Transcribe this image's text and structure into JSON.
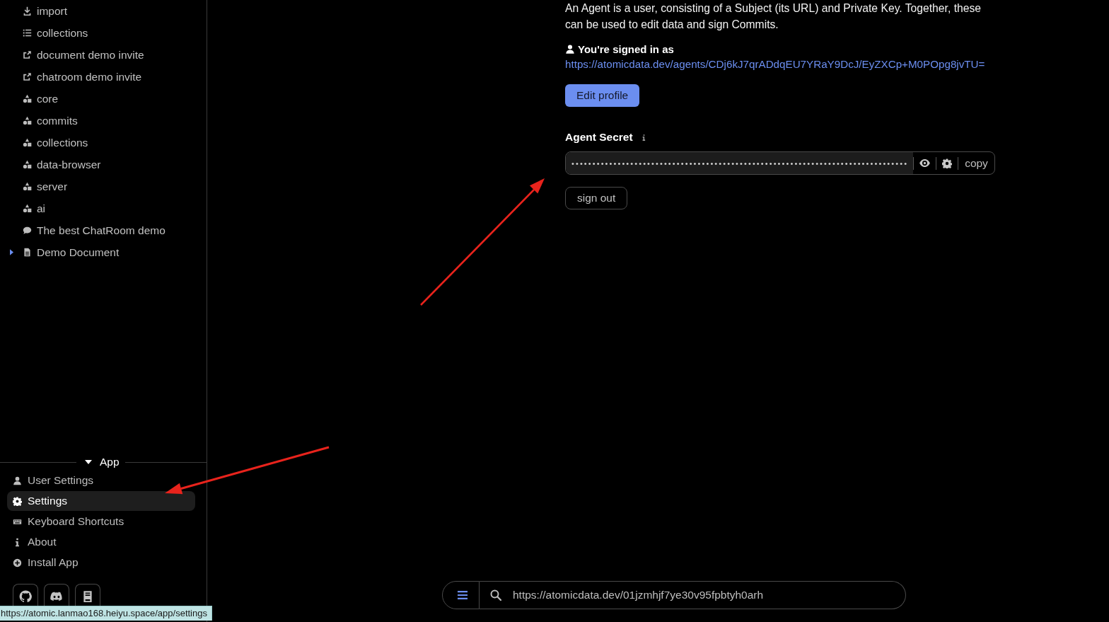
{
  "sidebar": {
    "items": [
      {
        "label": "import",
        "kind": "import",
        "selected": false
      },
      {
        "label": "collections",
        "kind": "collection",
        "selected": false
      },
      {
        "label": "document demo invite",
        "kind": "invite",
        "selected": false
      },
      {
        "label": "chatroom demo invite",
        "kind": "invite",
        "selected": false
      },
      {
        "label": "core",
        "kind": "ontology",
        "selected": false
      },
      {
        "label": "commits",
        "kind": "ontology",
        "selected": false
      },
      {
        "label": "collections",
        "kind": "ontology",
        "selected": false
      },
      {
        "label": "data-browser",
        "kind": "ontology",
        "selected": false
      },
      {
        "label": "server",
        "kind": "ontology",
        "selected": false
      },
      {
        "label": "ai",
        "kind": "ontology",
        "selected": false
      },
      {
        "label": "The best ChatRoom demo",
        "kind": "chatroom",
        "selected": false
      },
      {
        "label": "Demo Document",
        "kind": "document",
        "selected": false,
        "expanded": false
      }
    ],
    "app_menu": {
      "title": "App",
      "expanded": true,
      "items": [
        {
          "label": "User Settings",
          "kind": "user",
          "selected": false
        },
        {
          "label": "Settings",
          "kind": "settings",
          "selected": true
        },
        {
          "label": "Keyboard Shortcuts",
          "kind": "keyboard",
          "selected": false
        },
        {
          "label": "About",
          "kind": "about",
          "selected": false
        },
        {
          "label": "Install App",
          "kind": "install",
          "selected": false
        }
      ]
    },
    "footer_links": [
      {
        "kind": "github"
      },
      {
        "kind": "discord"
      },
      {
        "kind": "book"
      }
    ]
  },
  "agent": {
    "description": "An Agent is a user, consisting of a Subject (its URL) and Private Key. Together, these can be used to edit data and sign Commits.",
    "signed_in_label": "You're signed in as",
    "subject_link": "https://atomicdata.dev/agents/CDj6kJ7qrADdqEU7YRaY9DcJ/EyZXCp+M0POpg8jvTU=",
    "edit_button": "Edit profile",
    "secret": {
      "label": "Agent Secret",
      "value": "••••••••••••••••••••••••••••••••••••••••••••••••••••••••••••••••••••••••••••••••",
      "copy_button": "copy"
    },
    "sign_out_button": "sign out"
  },
  "navigation_bar": {
    "value": "https://atomicdata.dev/01jzmhjf7ye30v95fpbtyh0arh"
  },
  "status_bar": {
    "url": "https://atomic.lanmao168.heiyu.space/app/settings"
  }
}
